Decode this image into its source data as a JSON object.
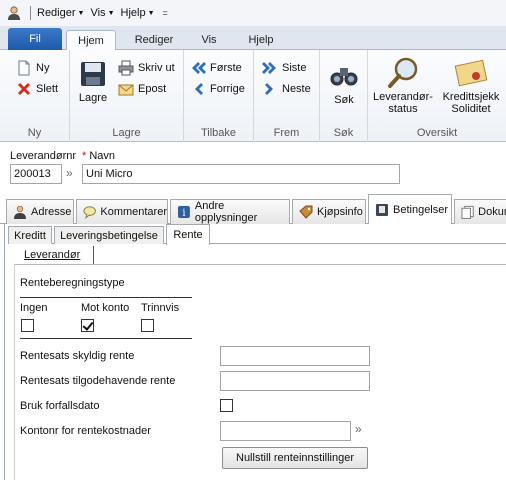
{
  "qat": {
    "menus": [
      "Rediger",
      "Vis",
      "Hjelp"
    ],
    "quick_access_glyph": "="
  },
  "ribbon_tabs": {
    "file": "Fil",
    "tabs": [
      "Hjem",
      "Rediger",
      "Vis",
      "Hjelp"
    ],
    "active": "Hjem"
  },
  "ribbon": {
    "ny": {
      "new": "Ny",
      "delete": "Slett",
      "label": "Ny"
    },
    "lagre": {
      "save": "Lagre",
      "print": "Skriv ut",
      "email": "Epost",
      "label": "Lagre"
    },
    "tilbake": {
      "first": "Første",
      "prev": "Forrige",
      "label": "Tilbake"
    },
    "frem": {
      "last": "Siste",
      "next": "Neste",
      "label": "Frem"
    },
    "sok": {
      "search": "Søk",
      "label": "Søk"
    },
    "oversikt": {
      "supplier_status_1": "Leverandør-",
      "supplier_status_2": "status",
      "credit_1": "Kredittsjekk",
      "credit_2": "Soliditet",
      "label": "Oversikt"
    }
  },
  "header": {
    "supplier_no_label": "Leverandørnr",
    "required_mark": "*",
    "name_label": "Navn",
    "supplier_no_value": "200013",
    "name_value": "Uni Micro"
  },
  "main_tabs": [
    "Adresse",
    "Kommentarer",
    "Andre opplysninger",
    "Kjøpsinfo",
    "Betingelser",
    "Dokum"
  ],
  "sub_tabs": [
    "Kreditt",
    "Leveringsbetingelse",
    "Rente"
  ],
  "inner_tab": "Leverandør",
  "interest": {
    "calc_type_label": "Renteberegningstype",
    "options": [
      "Ingen",
      "Mot konto",
      "Trinnvis"
    ],
    "options_checked": [
      false,
      true,
      false
    ],
    "rate_owed_label": "Rentesats skyldig rente",
    "rate_owed_value": "",
    "rate_receivable_label": "Rentesats tilgodehavende rente",
    "rate_receivable_value": "",
    "use_due_date_label": "Bruk forfallsdato",
    "use_due_date_checked": false,
    "account_label": "Kontonr for rentekostnader",
    "account_value": "",
    "reset_button": "Nullstill renteinnstillinger"
  }
}
